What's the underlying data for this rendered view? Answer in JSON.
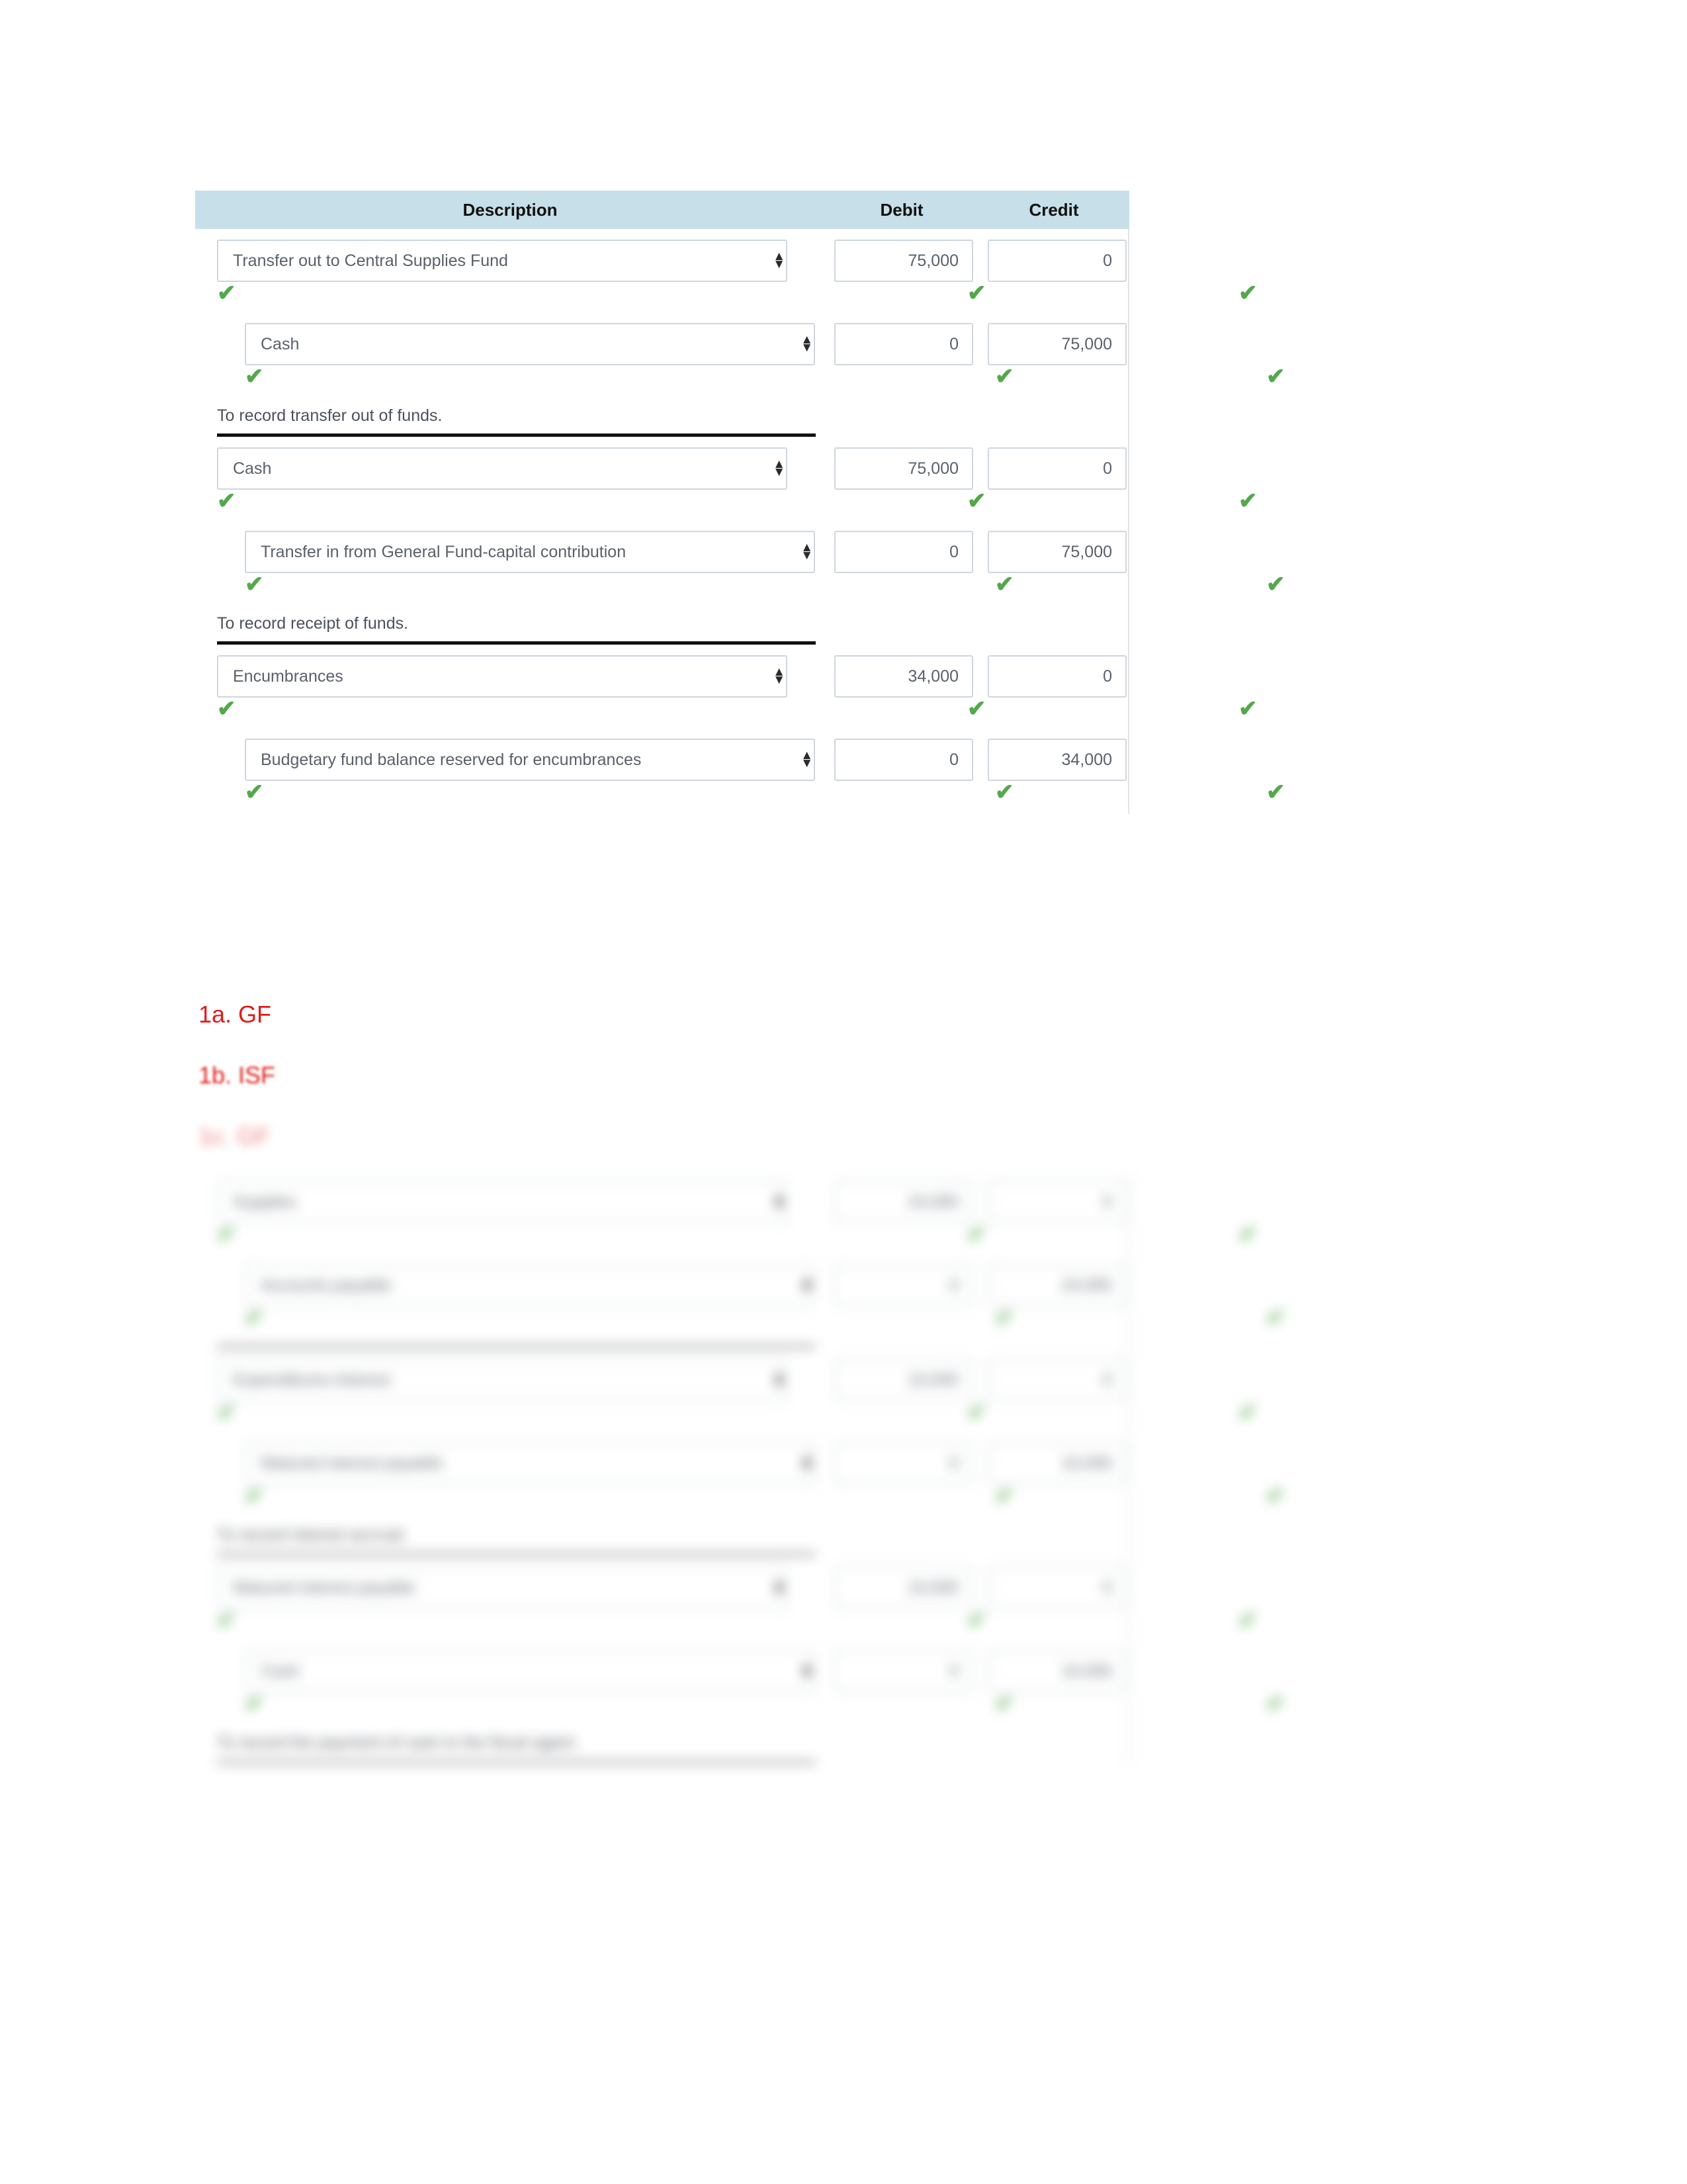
{
  "table": {
    "headers": {
      "description": "Description",
      "debit": "Debit",
      "credit": "Credit"
    },
    "header_bg": "#c6dfe8",
    "check_color": "#54a84b",
    "check_glyph": "✔",
    "arrow_up": "▲",
    "arrow_down": "▼",
    "entries": [
      {
        "lines": [
          {
            "account": "Transfer out to Central Supplies Fund",
            "debit": "75,000",
            "credit": "0",
            "indent": 0
          },
          {
            "account": "Cash",
            "debit": "0",
            "credit": "75,000",
            "indent": 1
          }
        ],
        "narrative": "To record transfer out of funds."
      },
      {
        "lines": [
          {
            "account": "Cash",
            "debit": "75,000",
            "credit": "0",
            "indent": 0
          },
          {
            "account": "Transfer in from General Fund-capital contribution",
            "debit": "0",
            "credit": "75,000",
            "indent": 1
          }
        ],
        "narrative": "To record receipt of funds."
      },
      {
        "lines": [
          {
            "account": "Encumbrances",
            "debit": "34,000",
            "credit": "0",
            "indent": 0
          },
          {
            "account": "Budgetary fund balance reserved for encumbrances",
            "debit": "0",
            "credit": "34,000",
            "indent": 1
          }
        ],
        "narrative": ""
      }
    ]
  },
  "annotations": {
    "color": "#e01b18",
    "line1": "1a. GF",
    "line2": "1b. ISF",
    "line3": "1c. GF"
  },
  "blurred_table": {
    "headers": {
      "description": "",
      "debit": "",
      "credit": ""
    },
    "entries": [
      {
        "lines": [
          {
            "account": "Supplies",
            "debit": "24,000",
            "credit": "0",
            "indent": 0
          },
          {
            "account": "Accounts payable",
            "debit": "0",
            "credit": "24,000",
            "indent": 1
          }
        ],
        "narrative": ""
      },
      {
        "lines": [
          {
            "account": "Expenditures-Interest",
            "debit": "10,000",
            "credit": "0",
            "indent": 0
          },
          {
            "account": "Matured interest payable",
            "debit": "0",
            "credit": "10,000",
            "indent": 1
          }
        ],
        "narrative": "To record interest accrual."
      },
      {
        "lines": [
          {
            "account": "Matured interest payable",
            "debit": "10,000",
            "credit": "0",
            "indent": 0
          },
          {
            "account": "Cash",
            "debit": "0",
            "credit": "10,000",
            "indent": 1
          }
        ],
        "narrative": "To record the payment of cash to the fiscal agent."
      }
    ]
  }
}
